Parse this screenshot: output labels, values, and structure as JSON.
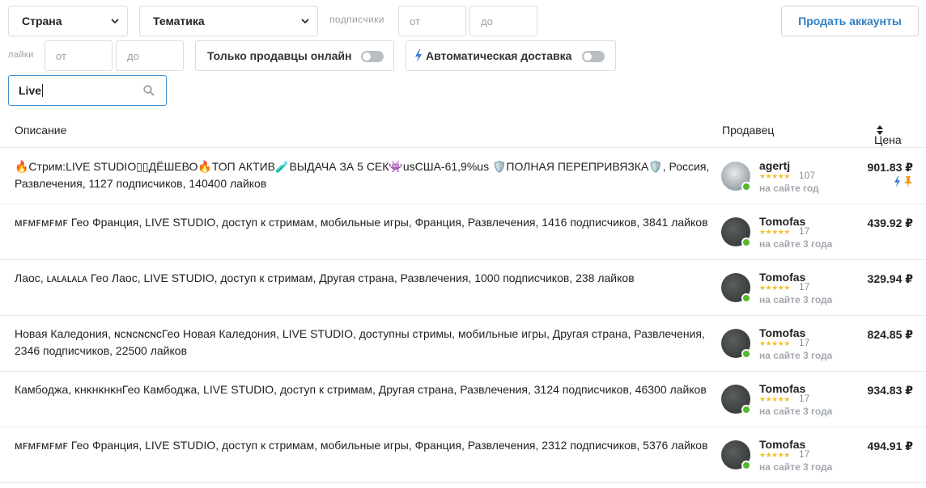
{
  "filters": {
    "country": "Страна",
    "theme": "Тематика",
    "subscribers_label": "подписчики",
    "likes_label": "лайки",
    "from_placeholder": "от",
    "to_placeholder": "до",
    "only_online": "Только продавцы онлайн",
    "auto_delivery": "Автоматическая доставка",
    "search_value": "Live",
    "sell_button": "Продать аккаунты"
  },
  "table": {
    "col_description": "Описание",
    "col_seller": "Продавец",
    "col_price": "Цена"
  },
  "rows": [
    {
      "description": "🔥Стрим:LIVE STUDIO▯▯ДЁШЕВО🔥ТОП АКТИВ🧪ВЫДАЧА ЗА 5 СЕК👾usСША-61,9%us 🛡️ПОЛНАЯ ПЕРЕПРИВЯЗКА🛡️, Россия, Развлечения, 1127 подписчиков, 140400 лайков",
      "seller": "agertj",
      "reviews": "107",
      "since": "на сайте год",
      "price": "901.83 ₽"
    },
    {
      "description": "ᴍꜰᴍꜰᴍꜰᴍꜰ Гео Франция, LIVE STUDIO, доступ к стримам, мобильные игры, Франция, Развлечения, 1416 подписчиков, 3841 лайков",
      "seller": "Tomofas",
      "reviews": "17",
      "since": "на сайте 3 года",
      "price": "439.92 ₽"
    },
    {
      "description": "Лаос, ʟᴀʟᴀʟᴀʟᴀ Гео Лаос, LIVE STUDIO, доступ к стримам, Другая страна, Развлечения, 1000 подписчиков, 238 лайков",
      "seller": "Tomofas",
      "reviews": "17",
      "since": "на сайте 3 года",
      "price": "329.94 ₽"
    },
    {
      "description": "Новая Каледония, ɴᴄɴᴄɴᴄɴᴄГео Новая Каледония, LIVE STUDIO, доступны стримы, мобильные игры, Другая страна, Развлечения, 2346 подписчиков, 22500 лайков",
      "seller": "Tomofas",
      "reviews": "17",
      "since": "на сайте 3 года",
      "price": "824.85 ₽"
    },
    {
      "description": "Камбоджа, ᴋʜᴋʜᴋʜᴋʜГео Камбоджа, LIVE STUDIO, доступ к стримам, Другая страна, Развлечения, 3124 подписчиков, 46300 лайков",
      "seller": "Tomofas",
      "reviews": "17",
      "since": "на сайте 3 года",
      "price": "934.83 ₽"
    },
    {
      "description": "ᴍꜰᴍꜰᴍꜰᴍꜰ Гео Франция, LIVE STUDIO, доступ к стримам, мобильные игры, Франция, Развлечения, 2312 подписчиков, 5376 лайков",
      "seller": "Tomofas",
      "reviews": "17",
      "since": "на сайте 3 года",
      "price": "494.91 ₽"
    }
  ],
  "colors": {
    "accent": "#2f7fc4",
    "online": "#56b82d",
    "stars": "#f2c12e"
  }
}
